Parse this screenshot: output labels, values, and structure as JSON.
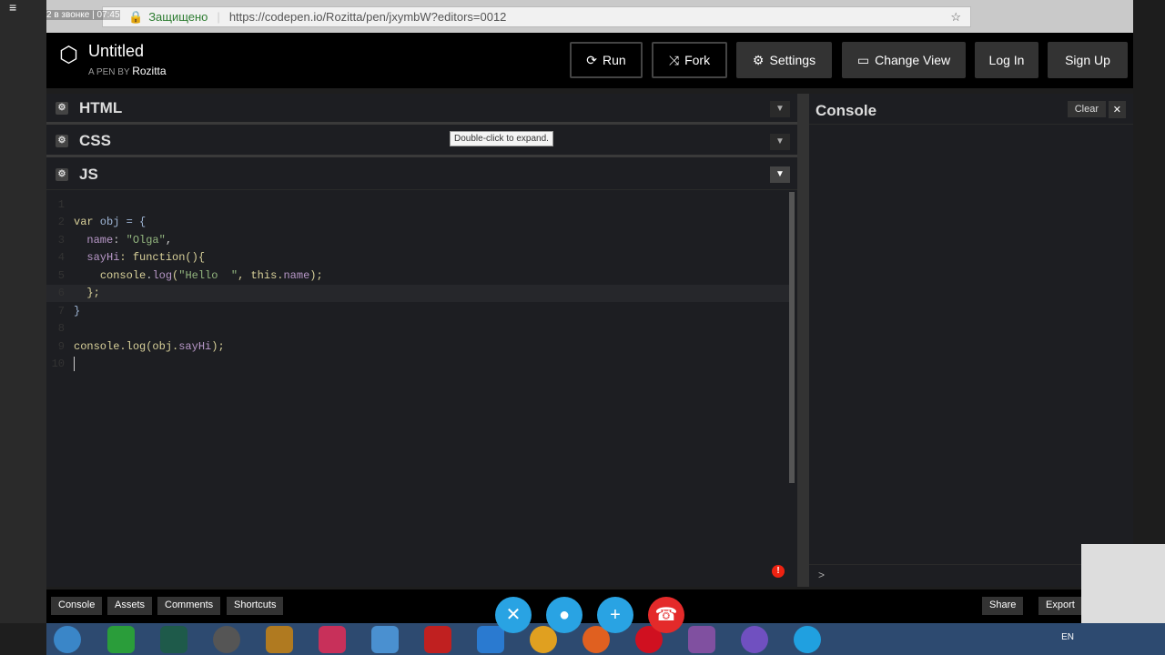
{
  "browser": {
    "call_status": "2 в звонке | 07:45",
    "secure_label": "Защищено",
    "url": "https://codepen.io/Rozitta/pen/jxymbW?editors=0012"
  },
  "header": {
    "title": "Untitled",
    "byline": "A PEN BY",
    "author": "Rozitta",
    "buttons": {
      "run": "Run",
      "fork": "Fork",
      "settings": "Settings",
      "change_view": "Change View",
      "login": "Log In",
      "signup": "Sign Up"
    }
  },
  "panels": {
    "html": "HTML",
    "css": "CSS",
    "js": "JS"
  },
  "tooltip": "Double-click to expand.",
  "code_lines": [
    "1",
    "2",
    "3",
    "4",
    "5",
    "6",
    "7",
    "8",
    "9",
    "10"
  ],
  "code": {
    "l2a": "var",
    "l2b": " obj = {",
    "l3a": "name",
    "l3b": ": ",
    "l3c": "\"Olga\"",
    "l3d": ",",
    "l4a": "sayHi",
    "l4b": ": function(){",
    "l5a": "console",
    "l5b": ".",
    "l5c": "log",
    "l5d": "(",
    "l5e": "\"Hello  \"",
    "l5f": ", this.",
    "l5g": "name",
    "l5h": ");",
    "l6": "};",
    "l7": "}",
    "l9a": "console",
    "l9b": ".log(obj.",
    "l9c": "sayHi",
    "l9d": ");"
  },
  "console": {
    "title": "Console",
    "clear": "Clear",
    "close": "✕",
    "prompt": ">"
  },
  "footer": {
    "console": "Console",
    "assets": "Assets",
    "comments": "Comments",
    "shortcuts": "Shortcuts",
    "share": "Share",
    "export": "Export"
  },
  "tray": {
    "lang": "EN"
  },
  "colors": {
    "accent_green": "#2e7d32",
    "call_blue": "#29a3e3",
    "hangup_red": "#e42a2a"
  }
}
